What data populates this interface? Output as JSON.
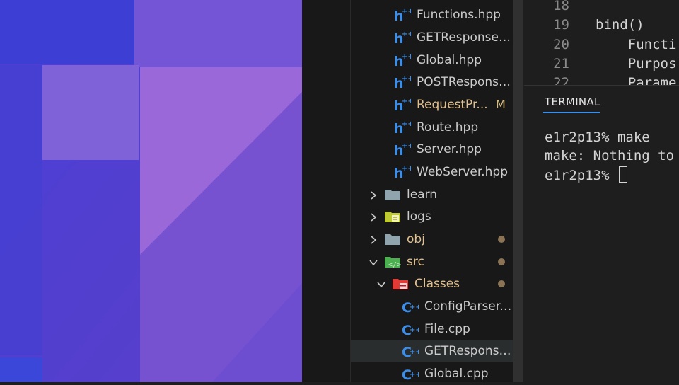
{
  "explorer": {
    "rows": [
      {
        "label": "Functions.hpp",
        "icon": "hpp-file-icon",
        "color": "#cccccc"
      },
      {
        "label": "GETResponse.hpp",
        "icon": "hpp-file-icon",
        "color": "#cccccc"
      },
      {
        "label": "Global.hpp",
        "icon": "hpp-file-icon",
        "color": "#cccccc"
      },
      {
        "label": "POSTResponse.hpp",
        "icon": "hpp-file-icon",
        "color": "#cccccc"
      },
      {
        "label": "RequestPr...",
        "icon": "hpp-file-icon",
        "color": "#e2c08d",
        "badge": "M"
      },
      {
        "label": "Route.hpp",
        "icon": "hpp-file-icon",
        "color": "#cccccc"
      },
      {
        "label": "Server.hpp",
        "icon": "hpp-file-icon",
        "color": "#cccccc"
      },
      {
        "label": "WebServer.hpp",
        "icon": "hpp-file-icon",
        "color": "#cccccc"
      },
      {
        "label": "learn",
        "icon": "folder-icon",
        "color": "#cccccc",
        "expanded": false
      },
      {
        "label": "logs",
        "icon": "logs-folder-icon",
        "color": "#cccccc",
        "expanded": false
      },
      {
        "label": "obj",
        "icon": "folder-icon",
        "color": "#e2c08d",
        "expanded": false,
        "modified": true
      },
      {
        "label": "src",
        "icon": "src-folder-icon",
        "color": "#e2c08d",
        "expanded": true,
        "modified": true
      },
      {
        "label": "Classes",
        "icon": "classes-folder-icon",
        "color": "#e2c08d",
        "expanded": true,
        "modified": true
      },
      {
        "label": "ConfigParser.cpp",
        "icon": "cpp-file-icon",
        "color": "#cccccc"
      },
      {
        "label": "File.cpp",
        "icon": "cpp-file-icon",
        "color": "#cccccc"
      },
      {
        "label": "GETResponse.cpp",
        "icon": "cpp-file-icon",
        "color": "#cccccc",
        "selected": true
      },
      {
        "label": "Global.cpp",
        "icon": "cpp-file-icon",
        "color": "#cccccc"
      }
    ]
  },
  "editor": {
    "lines": [
      {
        "num": "18",
        "text": ""
      },
      {
        "num": "19",
        "text": "bind()"
      },
      {
        "num": "20",
        "text": "    Functi"
      },
      {
        "num": "21",
        "text": "    Purpos"
      },
      {
        "num": "22",
        "text": "    Parame"
      }
    ]
  },
  "terminal": {
    "tab_label": "TERMINAL",
    "lines": [
      "e1r2p13% make",
      "make: Nothing to",
      "e1r2p13% "
    ]
  }
}
